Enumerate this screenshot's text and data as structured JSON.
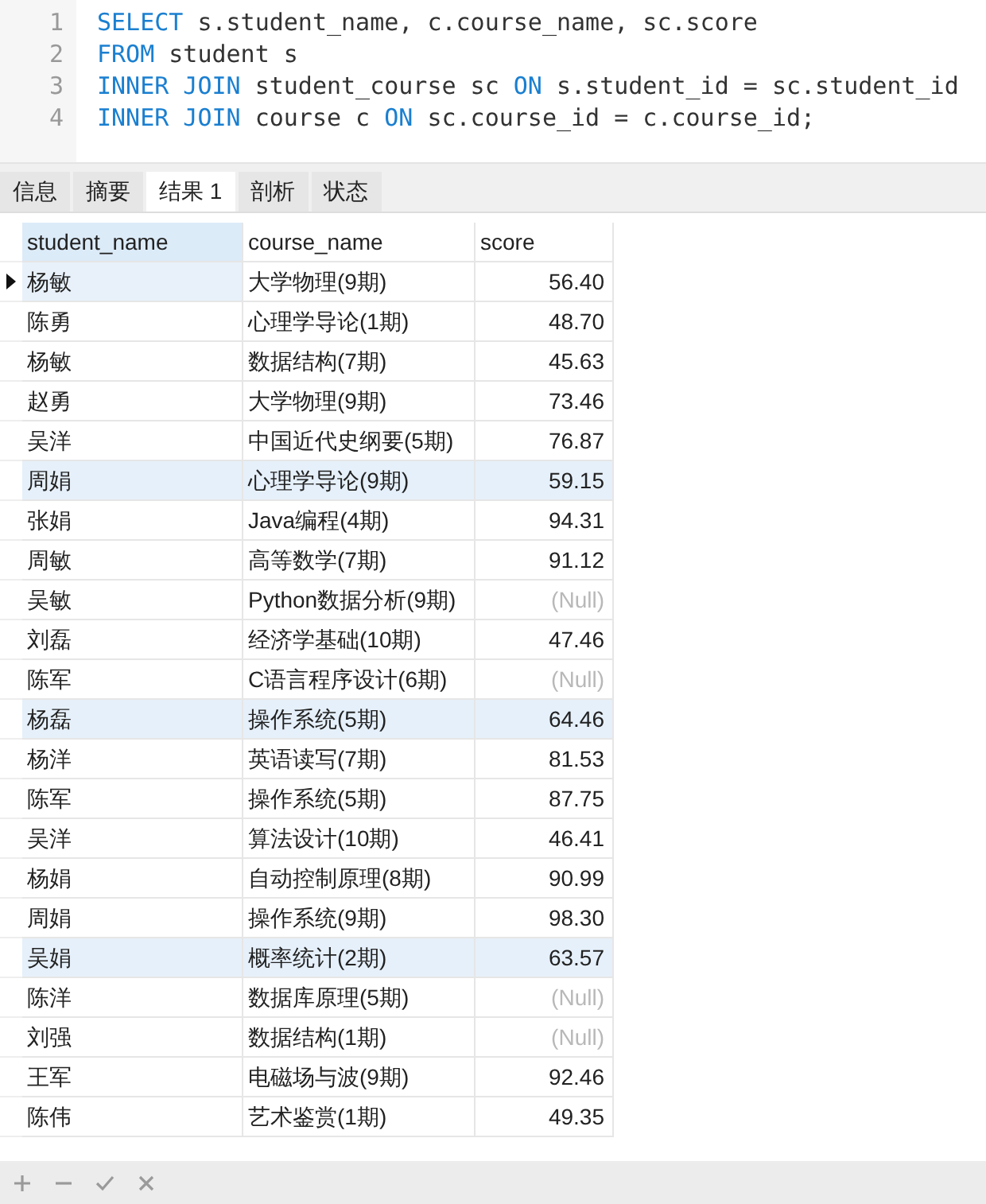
{
  "editor": {
    "lines": [
      {
        "number": "1",
        "tokens": [
          {
            "text": "SELECT",
            "kind": "keyword"
          },
          {
            "text": " s.student_name, c.course_name, sc.score",
            "kind": "plain"
          }
        ]
      },
      {
        "number": "2",
        "tokens": [
          {
            "text": "FROM",
            "kind": "keyword"
          },
          {
            "text": " student s",
            "kind": "plain"
          }
        ]
      },
      {
        "number": "3",
        "tokens": [
          {
            "text": "INNER JOIN",
            "kind": "keyword"
          },
          {
            "text": " student_course sc ",
            "kind": "plain"
          },
          {
            "text": "ON",
            "kind": "keyword"
          },
          {
            "text": " s.student_id = sc.student_id",
            "kind": "plain"
          }
        ]
      },
      {
        "number": "4",
        "tokens": [
          {
            "text": "INNER JOIN",
            "kind": "keyword"
          },
          {
            "text": " course c ",
            "kind": "plain"
          },
          {
            "text": "ON",
            "kind": "keyword"
          },
          {
            "text": " sc.course_id = c.course_id;",
            "kind": "plain"
          }
        ]
      }
    ]
  },
  "tabs": [
    {
      "label": "信息",
      "selected": false
    },
    {
      "label": "摘要",
      "selected": false
    },
    {
      "label": "结果 1",
      "selected": true
    },
    {
      "label": "剖析",
      "selected": false
    },
    {
      "label": "状态",
      "selected": false
    }
  ],
  "table": {
    "columns": [
      "student_name",
      "course_name",
      "score"
    ],
    "rows": [
      {
        "cells": [
          "杨敏",
          "大学物理(9期)",
          "56.40"
        ],
        "current": true,
        "highlighted": false,
        "is_null": false
      },
      {
        "cells": [
          "陈勇",
          "心理学导论(1期)",
          "48.70"
        ],
        "current": false,
        "highlighted": false,
        "is_null": false
      },
      {
        "cells": [
          "杨敏",
          "数据结构(7期)",
          "45.63"
        ],
        "current": false,
        "highlighted": false,
        "is_null": false
      },
      {
        "cells": [
          "赵勇",
          "大学物理(9期)",
          "73.46"
        ],
        "current": false,
        "highlighted": false,
        "is_null": false
      },
      {
        "cells": [
          "吴洋",
          "中国近代史纲要(5期)",
          "76.87"
        ],
        "current": false,
        "highlighted": false,
        "is_null": false
      },
      {
        "cells": [
          "周娟",
          "心理学导论(9期)",
          "59.15"
        ],
        "current": false,
        "highlighted": true,
        "is_null": false
      },
      {
        "cells": [
          "张娟",
          "Java编程(4期)",
          "94.31"
        ],
        "current": false,
        "highlighted": false,
        "is_null": false
      },
      {
        "cells": [
          "周敏",
          "高等数学(7期)",
          "91.12"
        ],
        "current": false,
        "highlighted": false,
        "is_null": false
      },
      {
        "cells": [
          "吴敏",
          "Python数据分析(9期)",
          "(Null)"
        ],
        "current": false,
        "highlighted": false,
        "is_null": true
      },
      {
        "cells": [
          "刘磊",
          "经济学基础(10期)",
          "47.46"
        ],
        "current": false,
        "highlighted": false,
        "is_null": false
      },
      {
        "cells": [
          "陈军",
          "C语言程序设计(6期)",
          "(Null)"
        ],
        "current": false,
        "highlighted": false,
        "is_null": true
      },
      {
        "cells": [
          "杨磊",
          "操作系统(5期)",
          "64.46"
        ],
        "current": false,
        "highlighted": true,
        "is_null": false
      },
      {
        "cells": [
          "杨洋",
          "英语读写(7期)",
          "81.53"
        ],
        "current": false,
        "highlighted": false,
        "is_null": false
      },
      {
        "cells": [
          "陈军",
          "操作系统(5期)",
          "87.75"
        ],
        "current": false,
        "highlighted": false,
        "is_null": false
      },
      {
        "cells": [
          "吴洋",
          "算法设计(10期)",
          "46.41"
        ],
        "current": false,
        "highlighted": false,
        "is_null": false
      },
      {
        "cells": [
          "杨娟",
          "自动控制原理(8期)",
          "90.99"
        ],
        "current": false,
        "highlighted": false,
        "is_null": false
      },
      {
        "cells": [
          "周娟",
          "操作系统(9期)",
          "98.30"
        ],
        "current": false,
        "highlighted": false,
        "is_null": false
      },
      {
        "cells": [
          "吴娟",
          "概率统计(2期)",
          "63.57"
        ],
        "current": false,
        "highlighted": true,
        "is_null": false
      },
      {
        "cells": [
          "陈洋",
          "数据库原理(5期)",
          "(Null)"
        ],
        "current": false,
        "highlighted": false,
        "is_null": true
      },
      {
        "cells": [
          "刘强",
          "数据结构(1期)",
          "(Null)"
        ],
        "current": false,
        "highlighted": false,
        "is_null": true
      },
      {
        "cells": [
          "王军",
          "电磁场与波(9期)",
          "92.46"
        ],
        "current": false,
        "highlighted": false,
        "is_null": false
      },
      {
        "cells": [
          "陈伟",
          "艺术鉴赏(1期)",
          "49.35"
        ],
        "current": false,
        "highlighted": false,
        "is_null": false
      }
    ]
  },
  "toolbar": [
    {
      "kind": "add",
      "disabled": true
    },
    {
      "kind": "delete",
      "disabled": true
    },
    {
      "kind": "apply",
      "disabled": true
    },
    {
      "kind": "cancel",
      "disabled": true
    }
  ]
}
